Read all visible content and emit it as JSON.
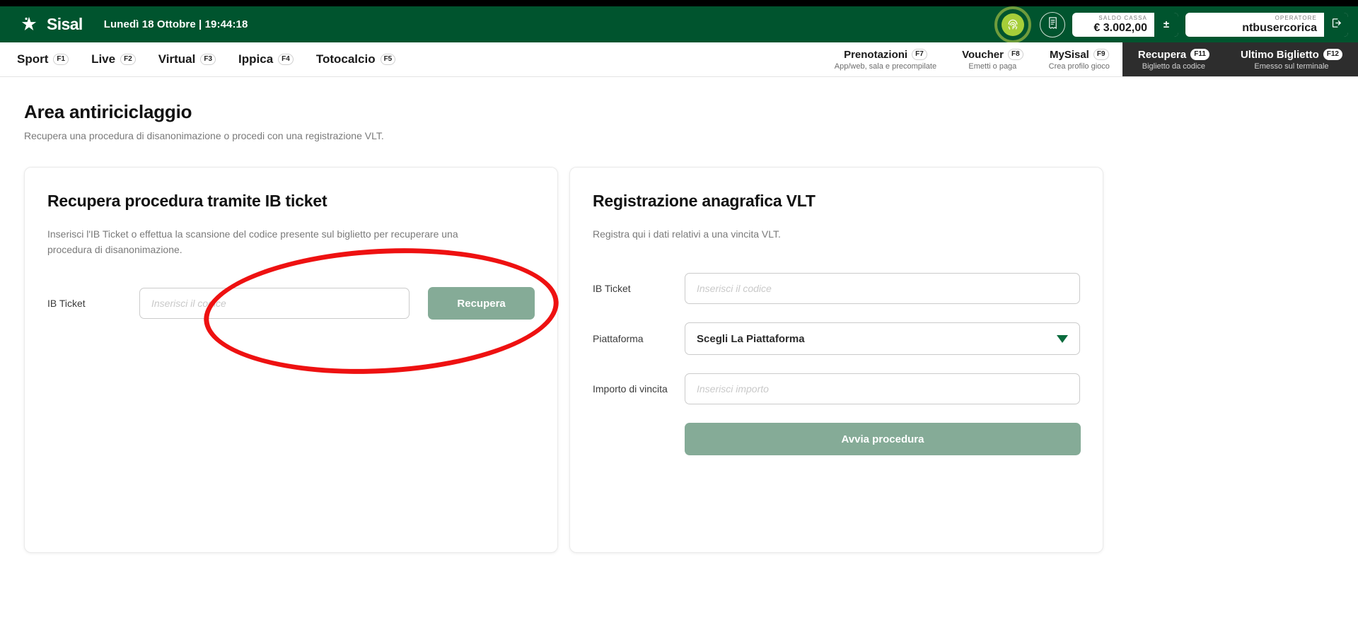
{
  "header": {
    "brand": "Sisal",
    "logo_icon": "sisal-star-icon",
    "datetime": "Lunedì 18 Ottobre | 19:44:18",
    "fingerprint_icon": "fingerprint-icon",
    "receipt_icon": "receipt-icon",
    "balance": {
      "label": "SALDO CASSA",
      "value": "€ 3.002,00",
      "button": "±"
    },
    "operator": {
      "label": "OPERATORE",
      "value": "ntbusercorica",
      "logout_icon": "logout-icon"
    }
  },
  "nav": {
    "left": [
      {
        "label": "Sport",
        "fkey": "F1"
      },
      {
        "label": "Live",
        "fkey": "F2"
      },
      {
        "label": "Virtual",
        "fkey": "F3"
      },
      {
        "label": "Ippica",
        "fkey": "F4"
      },
      {
        "label": "Totocalcio",
        "fkey": "F5"
      }
    ],
    "right": [
      {
        "label": "Prenotazioni",
        "fkey": "F7",
        "sub": "App/web, sala e precompilate"
      },
      {
        "label": "Voucher",
        "fkey": "F8",
        "sub": "Emetti o paga"
      },
      {
        "label": "MySisal",
        "fkey": "F9",
        "sub": "Crea profilo gioco"
      }
    ],
    "dark": [
      {
        "label": "Recupera",
        "fkey": "F11",
        "sub": "Biglietto da codice"
      },
      {
        "label": "Ultimo Biglietto",
        "fkey": "F12",
        "sub": "Emesso sul terminale"
      }
    ]
  },
  "page": {
    "title": "Area antiriciclaggio",
    "subtitle": "Recupera una procedura di disanonimazione o procedi con una registrazione VLT."
  },
  "left_card": {
    "title": "Recupera procedura tramite IB ticket",
    "description": "Inserisci l'IB Ticket o effettua la scansione del codice presente sul biglietto per recuperare una procedura di disanonimazione.",
    "ib_ticket_label": "IB Ticket",
    "ib_ticket_placeholder": "Inserisci il codice",
    "ib_ticket_value": "",
    "submit_label": "Recupera"
  },
  "right_card": {
    "title": "Registrazione anagrafica VLT",
    "description": "Registra qui i dati relativi a una vincita VLT.",
    "ib_ticket_label": "IB Ticket",
    "ib_ticket_placeholder": "Inserisci il codice",
    "ib_ticket_value": "",
    "platform_label": "Piattaforma",
    "platform_value": "Scegli La Piattaforma",
    "amount_label": "Importo di vincita",
    "amount_placeholder": "Inserisci importo",
    "amount_value": "",
    "submit_label": "Avvia procedura"
  },
  "annotation": {
    "shape": "red-ellipse",
    "color": "#ee1111"
  },
  "colors": {
    "header_green": "#00542e",
    "accent_lime": "#a6ce39",
    "button_green": "#85ab97",
    "dark_nav": "#2d2d2d",
    "annotation_red": "#ee1111"
  }
}
